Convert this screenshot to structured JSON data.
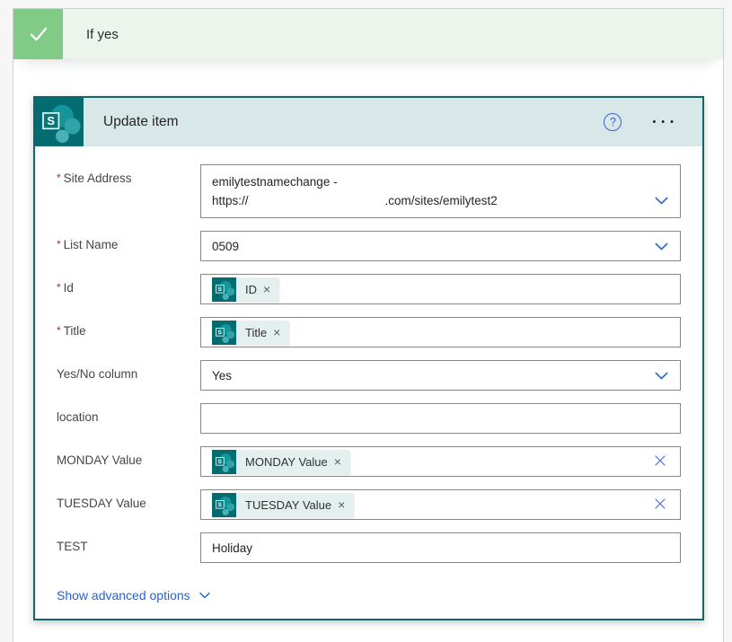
{
  "colors": {
    "condition_green": "#82cb87",
    "condition_bar_bg": "#ebf5ec",
    "card_border_teal": "#0d676c",
    "card_header_bg": "#d8e8e9",
    "sharepoint_teal": "#036c70",
    "chip_bg": "#e4efef",
    "accent_blue": "#2e6ad2",
    "clear_x_blue": "#4f6bed",
    "required_red": "#b0282e",
    "link_blue": "#2264d1"
  },
  "icons": {
    "help": "?",
    "ellipsis": "•••",
    "chip_remove": "×",
    "condition_check": "checkmark",
    "connector_logo": "sharepoint"
  },
  "condition": {
    "title": "If yes"
  },
  "action_card": {
    "title": "Update item",
    "connector": "SharePoint",
    "advanced_options_label": "Show advanced options",
    "fields": [
      {
        "label": "Site Address",
        "required": true,
        "type": "dropdown-two-line",
        "value_line1": "emilytestnamechange -",
        "value_line2_prefix": "https://",
        "value_line2_suffix": ".com/sites/emilytest2"
      },
      {
        "label": "List Name",
        "required": true,
        "type": "dropdown",
        "value": "0509"
      },
      {
        "label": "Id",
        "required": true,
        "type": "token",
        "token": "ID"
      },
      {
        "label": "Title",
        "required": true,
        "type": "token",
        "token": "Title"
      },
      {
        "label": "Yes/No column",
        "required": false,
        "type": "dropdown",
        "value": "Yes"
      },
      {
        "label": "location",
        "required": false,
        "type": "text",
        "value": "",
        "placeholder": ""
      },
      {
        "label": "MONDAY Value",
        "required": false,
        "type": "token-clearable",
        "token": "MONDAY Value"
      },
      {
        "label": "TUESDAY Value",
        "required": false,
        "type": "token-clearable",
        "token": "TUESDAY Value"
      },
      {
        "label": "TEST",
        "required": false,
        "type": "text",
        "value": "Holiday"
      }
    ]
  }
}
